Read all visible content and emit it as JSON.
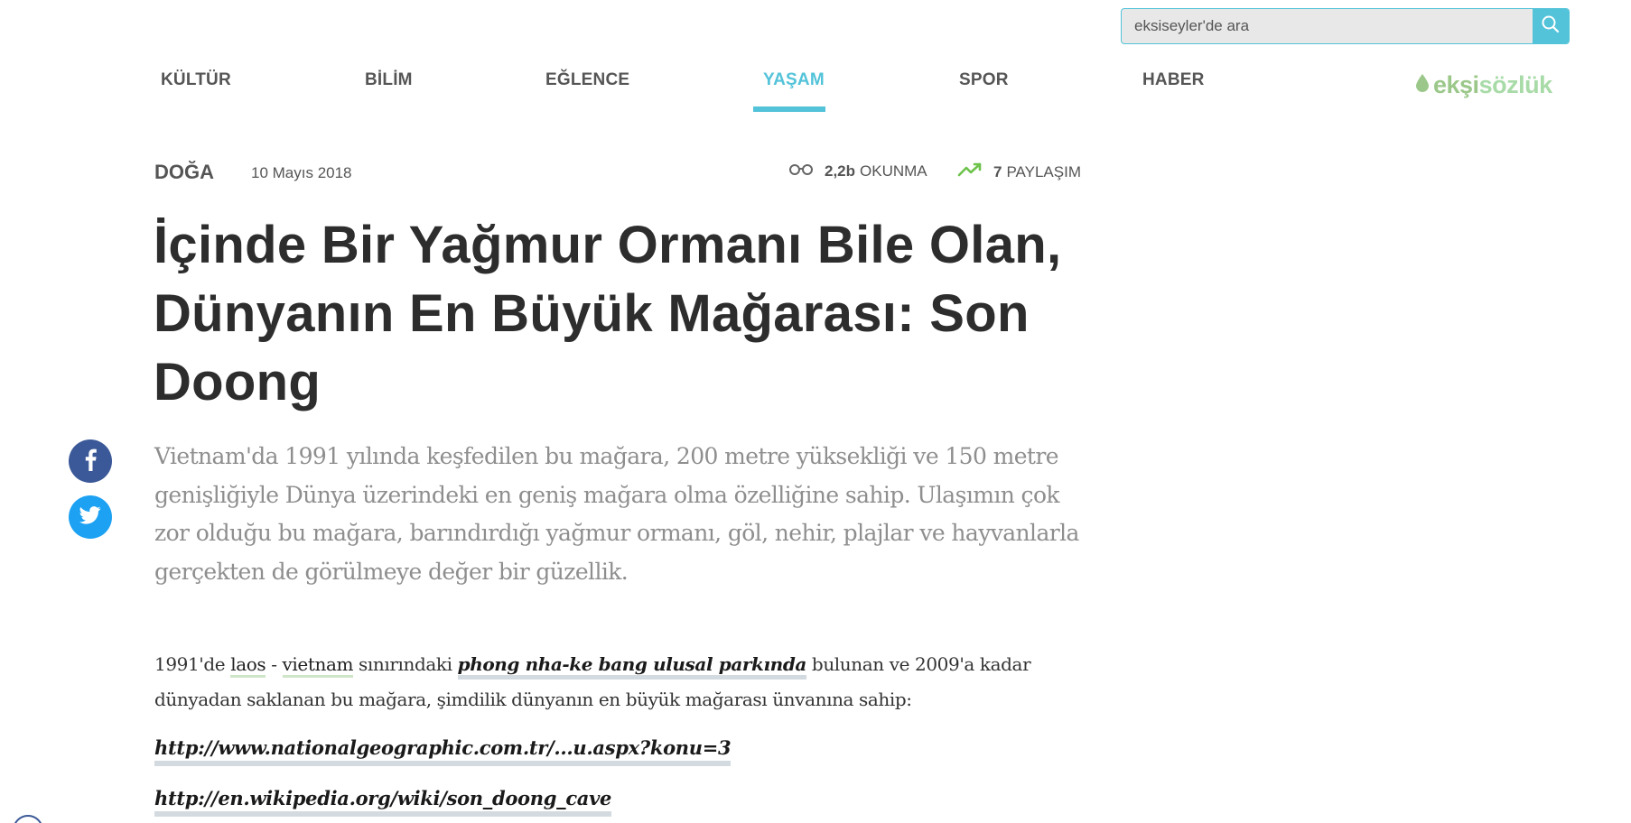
{
  "search": {
    "placeholder": "eksiseyler'de ara"
  },
  "nav": {
    "items": [
      {
        "label": "KÜLTÜR"
      },
      {
        "label": "BİLİM"
      },
      {
        "label": "EĞLENCE"
      },
      {
        "label": "YAŞAM",
        "active": true
      },
      {
        "label": "SPOR"
      },
      {
        "label": "HABER"
      }
    ]
  },
  "logo": {
    "part1": "ekşi",
    "part2": "sözlük"
  },
  "article": {
    "category": "DOĞA",
    "date": "10 Mayıs 2018",
    "reads_count": "2,2b",
    "reads_label": "OKUNMA",
    "shares_count": "7",
    "shares_label": "PAYLAŞIM",
    "title": "İçinde Bir Yağmur Ormanı Bile Olan, Dünyanın En Büyük Mağarası: Son Doong",
    "lead": "Vietnam'da 1991 yılında keşfedilen bu mağara, 200 metre yüksekliği ve 150 metre genişliğiyle Dünya üzerindeki en geniş mağara olma özelliğine sahip. Ulaşımın çok zor olduğu bu mağara, barındırdığı yağmur ormanı, göl, nehir, plajlar ve hayvanlarla gerçekten de görülmeye değer bir güzellik.",
    "body": {
      "t1": "1991'de ",
      "link_laos": "laos",
      "t2": " - ",
      "link_vietnam": "vietnam",
      "t3": " sınırındaki ",
      "link_park": "phong nha-ke bang ulusal parkında",
      "t4": " bulunan ve 2009'a kadar dünyadan saklanan bu mağara, şimdilik dünyanın en büyük mağarası ünvanına sahip:"
    },
    "url1": "http://www.nationalgeographic.com.tr/...u.aspx?konu=3",
    "url2": "http://en.wikipedia.org/wiki/son_doong_cave"
  },
  "colors": {
    "accent": "#53c3d9",
    "logo_green": "#9bc88a",
    "facebook": "#3b5998",
    "twitter": "#1da1f2",
    "trend_green": "#6cc24a"
  },
  "icons": {
    "search": "search-icon",
    "reads": "glasses-icon",
    "shares": "trending-up-icon",
    "facebook": "facebook-icon",
    "twitter": "twitter-icon",
    "logo_drop": "drop-icon"
  }
}
